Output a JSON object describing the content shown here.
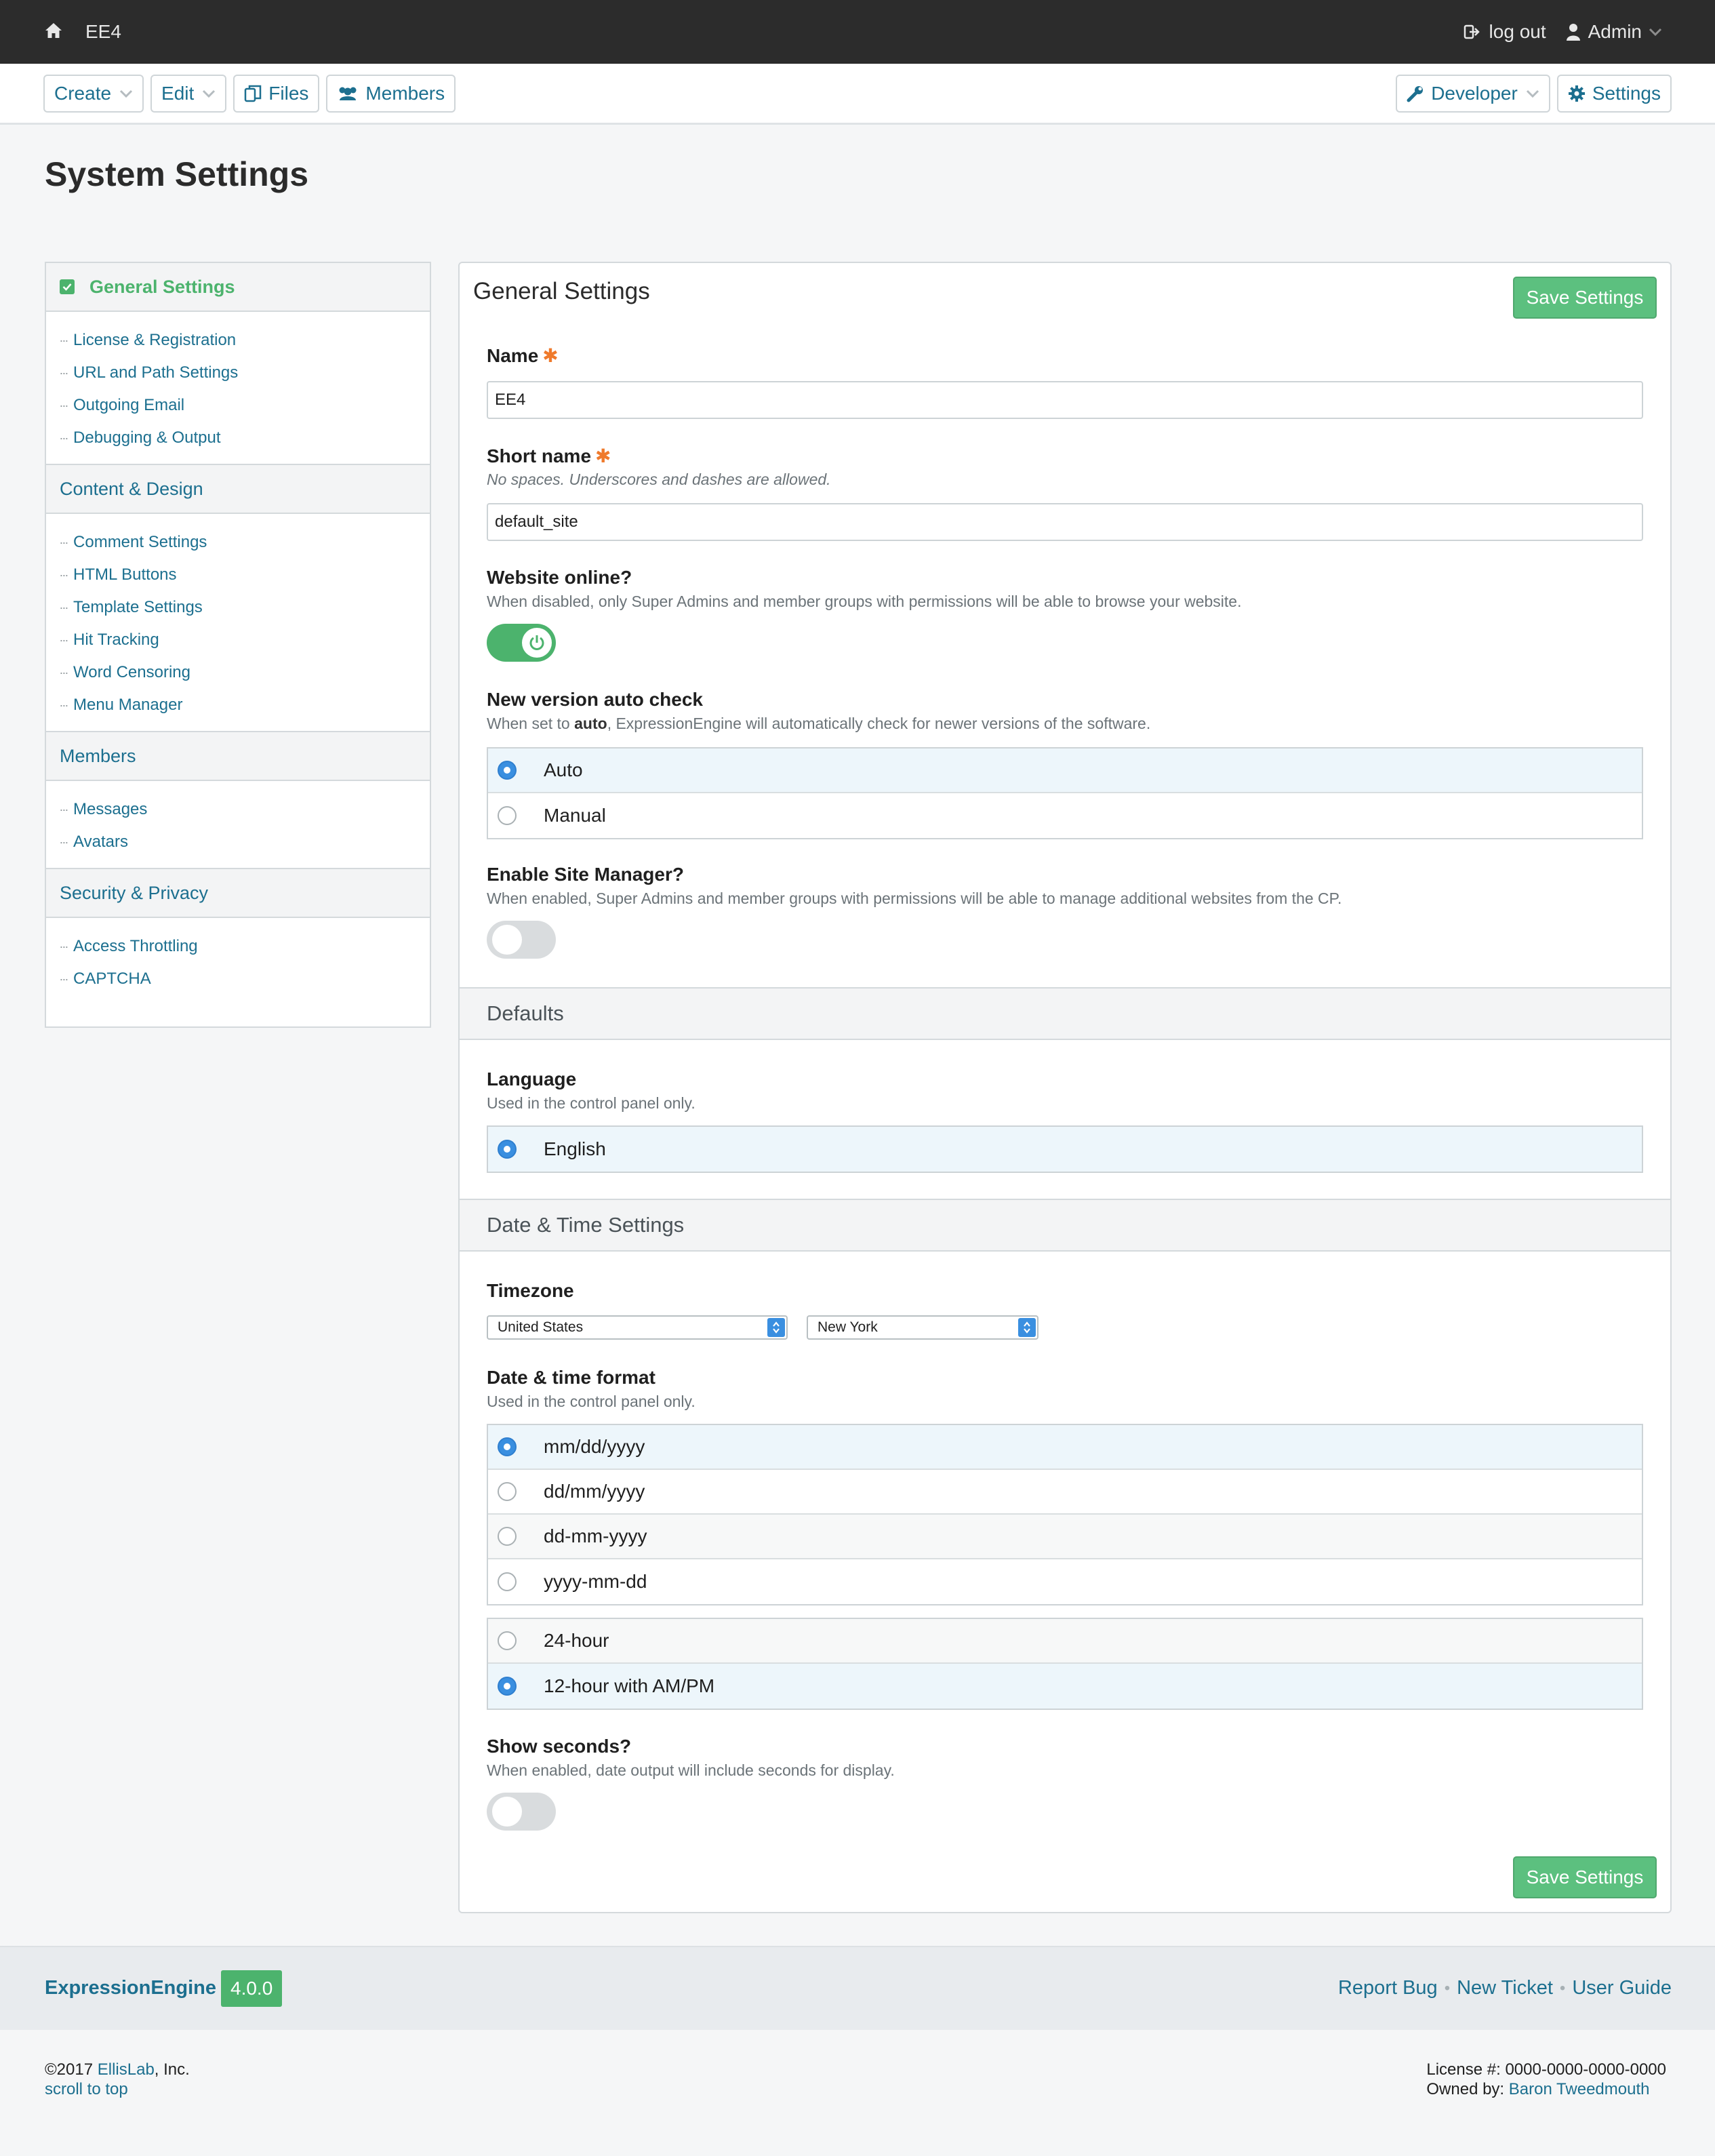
{
  "topbar": {
    "site_name": "EE4",
    "logout_label": "log out",
    "user_label": "Admin"
  },
  "navbar": {
    "create": "Create",
    "edit": "Edit",
    "files": "Files",
    "members": "Members",
    "developer": "Developer",
    "settings": "Settings"
  },
  "page_title": "System Settings",
  "sidebar": {
    "sections": [
      {
        "title": "General Settings",
        "items": [
          "License & Registration",
          "URL and Path Settings",
          "Outgoing Email",
          "Debugging & Output"
        ]
      },
      {
        "title": "Content & Design",
        "items": [
          "Comment Settings",
          "HTML Buttons",
          "Template Settings",
          "Hit Tracking",
          "Word Censoring",
          "Menu Manager"
        ]
      },
      {
        "title": "Members",
        "items": [
          "Messages",
          "Avatars"
        ]
      },
      {
        "title": "Security & Privacy",
        "items": [
          "Access Throttling",
          "CAPTCHA"
        ]
      }
    ],
    "dots": "∙∙∙"
  },
  "panel": {
    "title": "General Settings",
    "save_label": "Save Settings",
    "name": {
      "label": "Name",
      "required": "✱",
      "value": "EE4"
    },
    "short_name": {
      "label": "Short name",
      "required": "✱",
      "desc": "No spaces. Underscores and dashes are allowed.",
      "value": "default_site"
    },
    "website_online": {
      "label": "Website online?",
      "desc": "When disabled, only Super Admins and member groups with permissions will be able to browse your website.",
      "state": "on"
    },
    "version_check": {
      "label": "New version auto check",
      "desc_pre": "When set to ",
      "desc_bold": "auto",
      "desc_post": ", ExpressionEngine will automatically check for newer versions of the software.",
      "options": [
        "Auto",
        "Manual"
      ],
      "selected": "Auto"
    },
    "site_manager": {
      "label": "Enable Site Manager?",
      "desc": "When enabled, Super Admins and member groups with permissions will be able to manage additional websites from the CP.",
      "state": "off"
    },
    "defaults_heading": "Defaults",
    "language": {
      "label": "Language",
      "desc": "Used in the control panel only.",
      "options": [
        "English"
      ],
      "selected": "English"
    },
    "datetime_heading": "Date & Time Settings",
    "timezone": {
      "label": "Timezone",
      "country": "United States",
      "city": "New York"
    },
    "date_format": {
      "label": "Date & time format",
      "desc": "Used in the control panel only.",
      "options": [
        "mm/dd/yyyy",
        "dd/mm/yyyy",
        "dd-mm-yyyy",
        "yyyy-mm-dd"
      ],
      "selected": "mm/dd/yyyy"
    },
    "time_format": {
      "options": [
        "24-hour",
        "12-hour with AM/PM"
      ],
      "selected": "12-hour with AM/PM"
    },
    "show_seconds": {
      "label": "Show seconds?",
      "desc": "When enabled, date output will include seconds for display.",
      "state": "off"
    }
  },
  "footer": {
    "product": "ExpressionEngine",
    "version": "4.0.0",
    "links": [
      "Report Bug",
      "New Ticket",
      "User Guide"
    ],
    "copyright_pre": "©2017 ",
    "company_link": "EllisLab",
    "copyright_post": ", Inc.",
    "scroll_top": "scroll to top",
    "license_label": "License #: 0000-0000-0000-0000",
    "owned_by_label": "Owned by: ",
    "owner": "Baron Tweedmouth"
  },
  "colors": {
    "accent_green": "#4cb36d",
    "link_blue": "#1c6f8f",
    "required_orange": "#ef7a2c",
    "radio_blue": "#3a8fe0",
    "topbar_dark": "#2c2c2c"
  },
  "icons": [
    "home-icon",
    "logout-icon",
    "user-icon",
    "chevron-down-icon",
    "files-icon",
    "members-icon",
    "wrench-icon",
    "gear-icon",
    "check-icon",
    "power-icon",
    "select-arrows-icon"
  ]
}
